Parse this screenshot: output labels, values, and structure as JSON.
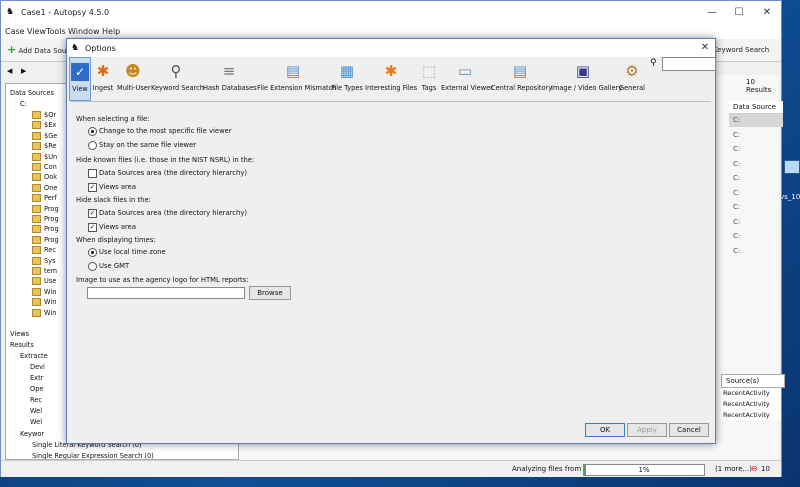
{
  "app": {
    "title": "Case1 - Autopsy 4.5.0",
    "menu": [
      "Case",
      "View",
      "Tools",
      "Window",
      "Help"
    ],
    "toolbar": {
      "add_data_source": "Add Data Sou",
      "keyword_search": "Keyword Search"
    },
    "results_count": "10   Results",
    "data_source_header": "Data Source",
    "data_source_rows": [
      "C:",
      "C:",
      "C:",
      "C:",
      "C:",
      "C:",
      "C:",
      "C:",
      "C:",
      "C:"
    ],
    "sources_header": "Source(s)",
    "sources_rows": [
      "RecentActivity",
      "RecentActivity",
      "RecentActivity"
    ]
  },
  "tree": {
    "root": "Data Sources",
    "drive": "C:",
    "items": [
      "$Or",
      "$Ex",
      "$Ge",
      "$Re",
      "$Un",
      "Con",
      "Ook",
      "One",
      "Perf",
      "Prog",
      "Prog",
      "Prog",
      "Prog",
      "Rec",
      "Sys",
      "tem",
      "Use",
      "Win",
      "Win",
      "Win"
    ],
    "views": "Views",
    "results": "Results",
    "extracted": "Extracte",
    "extracted_items": [
      "Devi",
      "Extr",
      "Ope",
      "Rec",
      "Wel",
      "Wel"
    ],
    "keyword": "Keywor",
    "keyword_items": [
      "Single Literal Keyword Search (0)",
      "Single Regular Expression Search (0)"
    ]
  },
  "status": {
    "analyzing": "Analyzing files from C:",
    "progress_label": "1%",
    "progress_value": 0.01,
    "more": "(1 more...)",
    "error_count": "10"
  },
  "desktop": {
    "icon_label": "vs_10_"
  },
  "dialog": {
    "title": "Options",
    "tabs": [
      {
        "label": "View",
        "icon": "view-check-icon",
        "active": true
      },
      {
        "label": "Ingest",
        "icon": "ingest-icon"
      },
      {
        "label": "Multi-User",
        "icon": "multi-user-icon"
      },
      {
        "label": "Keyword Search",
        "icon": "magnifier-icon"
      },
      {
        "label": "Hash Databases",
        "icon": "database-icon"
      },
      {
        "label": "File Extension Mismatch",
        "icon": "file-ext-icon"
      },
      {
        "label": "File Types",
        "icon": "file-type-icon"
      },
      {
        "label": "Interesting Files",
        "icon": "asterisk-icon"
      },
      {
        "label": "Tags",
        "icon": "tag-icon"
      },
      {
        "label": "External Viewer",
        "icon": "window-icon"
      },
      {
        "label": "Central Repository",
        "icon": "repository-icon"
      },
      {
        "label": "Image / Video Gallery",
        "icon": "gallery-icon"
      },
      {
        "label": "General",
        "icon": "tools-icon"
      }
    ],
    "view": {
      "selecting_label": "When selecting a file:",
      "opt_change": "Change to the most specific file viewer",
      "opt_stay": "Stay on the same file viewer",
      "hide_known_label": "Hide known files (i.e. those in the NIST NSRL) in the:",
      "known_ds": "Data Sources area (the directory hierarchy)",
      "known_views": "Views area",
      "hide_slack_label": "Hide slack files in the:",
      "slack_ds": "Data Sources area (the directory hierarchy)",
      "slack_views": "Views area",
      "times_label": "When displaying times:",
      "opt_local_tz": "Use local time zone",
      "opt_gmt": "Use GMT",
      "logo_label": "Image to use as the agency logo for HTML reports:",
      "logo_value": "",
      "browse": "Browse"
    },
    "ok": "OK",
    "apply": "Apply",
    "cancel": "Cancel"
  }
}
